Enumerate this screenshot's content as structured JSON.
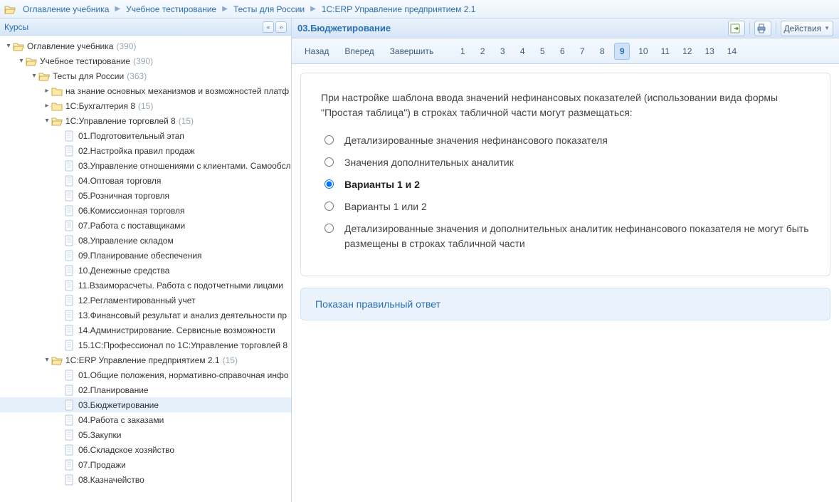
{
  "breadcrumbs": [
    "Оглавление учебника",
    "Учебное тестирование",
    "Тесты для России",
    "1С:ERP Управление предприятием 2.1"
  ],
  "sidebar": {
    "title": "Курсы",
    "selected_id": "erp-03",
    "nodes": [
      {
        "id": "root",
        "depth": 0,
        "icon": "folder-open",
        "toggle": "open",
        "label": "Оглавление учебника",
        "count": "(390)"
      },
      {
        "id": "testing",
        "depth": 1,
        "icon": "folder-open",
        "toggle": "open",
        "label": "Учебное тестирование",
        "count": "(390)"
      },
      {
        "id": "russia",
        "depth": 2,
        "icon": "folder-open",
        "toggle": "open",
        "label": "Тесты для России",
        "count": "(363)"
      },
      {
        "id": "mech",
        "depth": 3,
        "icon": "folder",
        "toggle": "closed",
        "label": "на знание основных механизмов и возможностей платф"
      },
      {
        "id": "buh8",
        "depth": 3,
        "icon": "folder",
        "toggle": "closed",
        "label": "1С:Бухгалтерия 8",
        "count": "(15)"
      },
      {
        "id": "ut8",
        "depth": 3,
        "icon": "folder-open",
        "toggle": "open",
        "label": "1С:Управление торговлей 8",
        "count": "(15)"
      },
      {
        "id": "ut-01",
        "depth": 4,
        "icon": "page",
        "toggle": "none",
        "label": "01.Подготовительный этап"
      },
      {
        "id": "ut-02",
        "depth": 4,
        "icon": "page",
        "toggle": "none",
        "label": "02.Настройка правил продаж"
      },
      {
        "id": "ut-03",
        "depth": 4,
        "icon": "page",
        "toggle": "none",
        "label": "03.Управление отношениями с клиентами. Самообсл"
      },
      {
        "id": "ut-04",
        "depth": 4,
        "icon": "page",
        "toggle": "none",
        "label": "04.Оптовая торговля"
      },
      {
        "id": "ut-05",
        "depth": 4,
        "icon": "page",
        "toggle": "none",
        "label": "05.Розничная торговля"
      },
      {
        "id": "ut-06",
        "depth": 4,
        "icon": "page",
        "toggle": "none",
        "label": "06.Комиссионная торговля"
      },
      {
        "id": "ut-07",
        "depth": 4,
        "icon": "page",
        "toggle": "none",
        "label": "07.Работа с поставщиками"
      },
      {
        "id": "ut-08",
        "depth": 4,
        "icon": "page",
        "toggle": "none",
        "label": "08.Управление складом"
      },
      {
        "id": "ut-09",
        "depth": 4,
        "icon": "page",
        "toggle": "none",
        "label": "09.Планирование обеспечения"
      },
      {
        "id": "ut-10",
        "depth": 4,
        "icon": "page",
        "toggle": "none",
        "label": "10.Денежные средства"
      },
      {
        "id": "ut-11",
        "depth": 4,
        "icon": "page",
        "toggle": "none",
        "label": "11.Взаиморасчеты. Работа с подотчетными лицами"
      },
      {
        "id": "ut-12",
        "depth": 4,
        "icon": "page",
        "toggle": "none",
        "label": "12.Регламентированный учет"
      },
      {
        "id": "ut-13",
        "depth": 4,
        "icon": "page",
        "toggle": "none",
        "label": "13.Финансовый результат и анализ деятельности пр"
      },
      {
        "id": "ut-14",
        "depth": 4,
        "icon": "page",
        "toggle": "none",
        "label": "14.Администрирование. Сервисные возможности"
      },
      {
        "id": "ut-15",
        "depth": 4,
        "icon": "page",
        "toggle": "none",
        "label": "15.1С:Профессионал по 1С:Управление торговлей 8"
      },
      {
        "id": "erp",
        "depth": 3,
        "icon": "folder-open",
        "toggle": "open",
        "label": "1С:ERP Управление предприятием 2.1",
        "count": "(15)"
      },
      {
        "id": "erp-01",
        "depth": 4,
        "icon": "page",
        "toggle": "none",
        "label": "01.Общие положения, нормативно-справочная инфо"
      },
      {
        "id": "erp-02",
        "depth": 4,
        "icon": "page",
        "toggle": "none",
        "label": "02.Планирование"
      },
      {
        "id": "erp-03",
        "depth": 4,
        "icon": "page",
        "toggle": "none",
        "label": "03.Бюджетирование"
      },
      {
        "id": "erp-04",
        "depth": 4,
        "icon": "page",
        "toggle": "none",
        "label": "04.Работа с заказами"
      },
      {
        "id": "erp-05",
        "depth": 4,
        "icon": "page",
        "toggle": "none",
        "label": "05.Закупки"
      },
      {
        "id": "erp-06",
        "depth": 4,
        "icon": "page",
        "toggle": "none",
        "label": "06.Складское хозяйство"
      },
      {
        "id": "erp-07",
        "depth": 4,
        "icon": "page",
        "toggle": "none",
        "label": "07.Продажи"
      },
      {
        "id": "erp-08",
        "depth": 4,
        "icon": "page",
        "toggle": "none",
        "label": "08.Казначейство"
      }
    ]
  },
  "main": {
    "title": "03.Бюджетирование",
    "actions_label": "Действия",
    "pager": {
      "back": "Назад",
      "forward": "Вперед",
      "finish": "Завершить",
      "pages": [
        "1",
        "2",
        "3",
        "4",
        "5",
        "6",
        "7",
        "8",
        "9",
        "10",
        "11",
        "12",
        "13",
        "14"
      ],
      "current": "9"
    },
    "question": "При настройке шаблона ввода значений нефинансовых показателей (использовании вида формы \"Простая таблица\") в строках табличной части могут размещаться:",
    "options": [
      {
        "text": "Детализированные значения нефинансового показателя",
        "correct": false
      },
      {
        "text": "Значения дополнительных аналитик",
        "correct": false
      },
      {
        "text": "Варианты 1 и 2",
        "correct": true
      },
      {
        "text": "Варианты 1 или 2",
        "correct": false
      },
      {
        "text": "Детализированные значения и дополнительных аналитик нефинансового показателя не могут быть размещены в строках табличной части",
        "correct": false
      }
    ],
    "banner": "Показан правильный ответ"
  }
}
